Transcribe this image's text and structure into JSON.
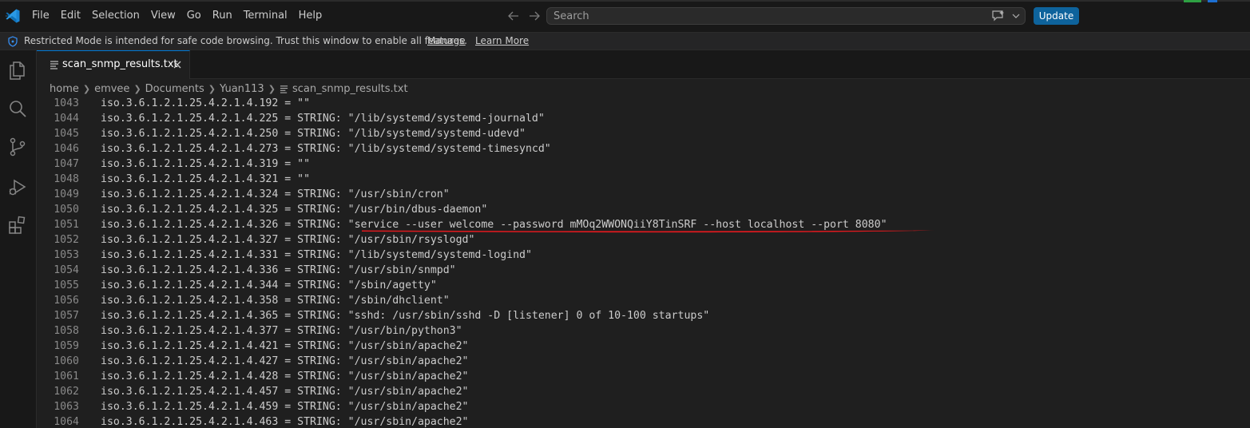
{
  "titlebar": {
    "menu": [
      "File",
      "Edit",
      "Selection",
      "View",
      "Go",
      "Run",
      "Terminal",
      "Help"
    ],
    "search_placeholder": "Search",
    "update_label": "Update",
    "accent": "#0e639c"
  },
  "banner": {
    "message": "Restricted Mode is intended for safe code browsing. Trust this window to enable all features.",
    "manage_label": "Manage",
    "learn_label": "Learn More"
  },
  "activity_icons": [
    "explorer-icon",
    "search-icon",
    "source-control-icon",
    "run-debug-icon",
    "extensions-icon"
  ],
  "tab": {
    "label": "scan_snmp_results.txt"
  },
  "breadcrumb": [
    "home",
    "emvee",
    "Documents",
    "Yuan113",
    "scan_snmp_results.txt"
  ],
  "editor": {
    "lines": [
      {
        "num": "1043",
        "text": "iso.3.6.1.2.1.25.4.2.1.4.192 = \"\""
      },
      {
        "num": "1044",
        "text": "iso.3.6.1.2.1.25.4.2.1.4.225 = STRING: \"/lib/systemd/systemd-journald\""
      },
      {
        "num": "1045",
        "text": "iso.3.6.1.2.1.25.4.2.1.4.250 = STRING: \"/lib/systemd/systemd-udevd\""
      },
      {
        "num": "1046",
        "text": "iso.3.6.1.2.1.25.4.2.1.4.273 = STRING: \"/lib/systemd/systemd-timesyncd\""
      },
      {
        "num": "1047",
        "text": "iso.3.6.1.2.1.25.4.2.1.4.319 = \"\""
      },
      {
        "num": "1048",
        "text": "iso.3.6.1.2.1.25.4.2.1.4.321 = \"\""
      },
      {
        "num": "1049",
        "text": "iso.3.6.1.2.1.25.4.2.1.4.324 = STRING: \"/usr/sbin/cron\""
      },
      {
        "num": "1050",
        "text": "iso.3.6.1.2.1.25.4.2.1.4.325 = STRING: \"/usr/bin/dbus-daemon\""
      },
      {
        "num": "1051",
        "text": "iso.3.6.1.2.1.25.4.2.1.4.326 = STRING: \"service --user welcome --password mMOq2WWONQiiY8TinSRF --host localhost --port 8080\""
      },
      {
        "num": "1052",
        "text": "iso.3.6.1.2.1.25.4.2.1.4.327 = STRING: \"/usr/sbin/rsyslogd\""
      },
      {
        "num": "1053",
        "text": "iso.3.6.1.2.1.25.4.2.1.4.331 = STRING: \"/lib/systemd/systemd-logind\""
      },
      {
        "num": "1054",
        "text": "iso.3.6.1.2.1.25.4.2.1.4.336 = STRING: \"/usr/sbin/snmpd\""
      },
      {
        "num": "1055",
        "text": "iso.3.6.1.2.1.25.4.2.1.4.344 = STRING: \"/sbin/agetty\""
      },
      {
        "num": "1056",
        "text": "iso.3.6.1.2.1.25.4.2.1.4.358 = STRING: \"/sbin/dhclient\""
      },
      {
        "num": "1057",
        "text": "iso.3.6.1.2.1.25.4.2.1.4.365 = STRING: \"sshd: /usr/sbin/sshd -D [listener] 0 of 10-100 startups\""
      },
      {
        "num": "1058",
        "text": "iso.3.6.1.2.1.25.4.2.1.4.377 = STRING: \"/usr/bin/python3\""
      },
      {
        "num": "1059",
        "text": "iso.3.6.1.2.1.25.4.2.1.4.421 = STRING: \"/usr/sbin/apache2\""
      },
      {
        "num": "1060",
        "text": "iso.3.6.1.2.1.25.4.2.1.4.427 = STRING: \"/usr/sbin/apache2\""
      },
      {
        "num": "1061",
        "text": "iso.3.6.1.2.1.25.4.2.1.4.428 = STRING: \"/usr/sbin/apache2\""
      },
      {
        "num": "1062",
        "text": "iso.3.6.1.2.1.25.4.2.1.4.457 = STRING: \"/usr/sbin/apache2\""
      },
      {
        "num": "1063",
        "text": "iso.3.6.1.2.1.25.4.2.1.4.459 = STRING: \"/usr/sbin/apache2\""
      },
      {
        "num": "1064",
        "text": "iso.3.6.1.2.1.25.4.2.1.4.463 = STRING: \"/usr/sbin/apache2\""
      }
    ],
    "annotation_color": "#e0191e"
  }
}
